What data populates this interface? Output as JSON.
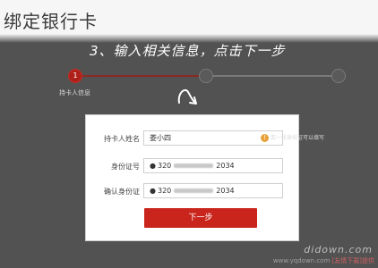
{
  "page": {
    "title": "绑定银行卡"
  },
  "instruction": "3、输入相关信息，点击下一步",
  "steps": [
    {
      "label": "持卡人信息",
      "active": true,
      "number": "1"
    },
    {
      "label": "",
      "active": false,
      "number": ""
    },
    {
      "label": "",
      "active": false,
      "number": ""
    }
  ],
  "form": {
    "rows": [
      {
        "label": "持卡人姓名",
        "value": "娄小四",
        "prefix": ""
      },
      {
        "label": "身份证号",
        "value_start": "320",
        "value_end": "2034",
        "prefix": "●"
      },
      {
        "label": "确认身份证",
        "value_start": "320",
        "value_end": "2034",
        "prefix": "●"
      }
    ],
    "tip": "若一张身份证可以填写",
    "next_button": "下一步"
  },
  "watermarks": {
    "site": "didown.com",
    "footer_prefix": "www.yqdown.com",
    "footer_brand": "[友情下载]提供"
  },
  "colors": {
    "accent": "#c9251c",
    "overlay": "#525252",
    "tip_icon": "#e8a23a"
  }
}
